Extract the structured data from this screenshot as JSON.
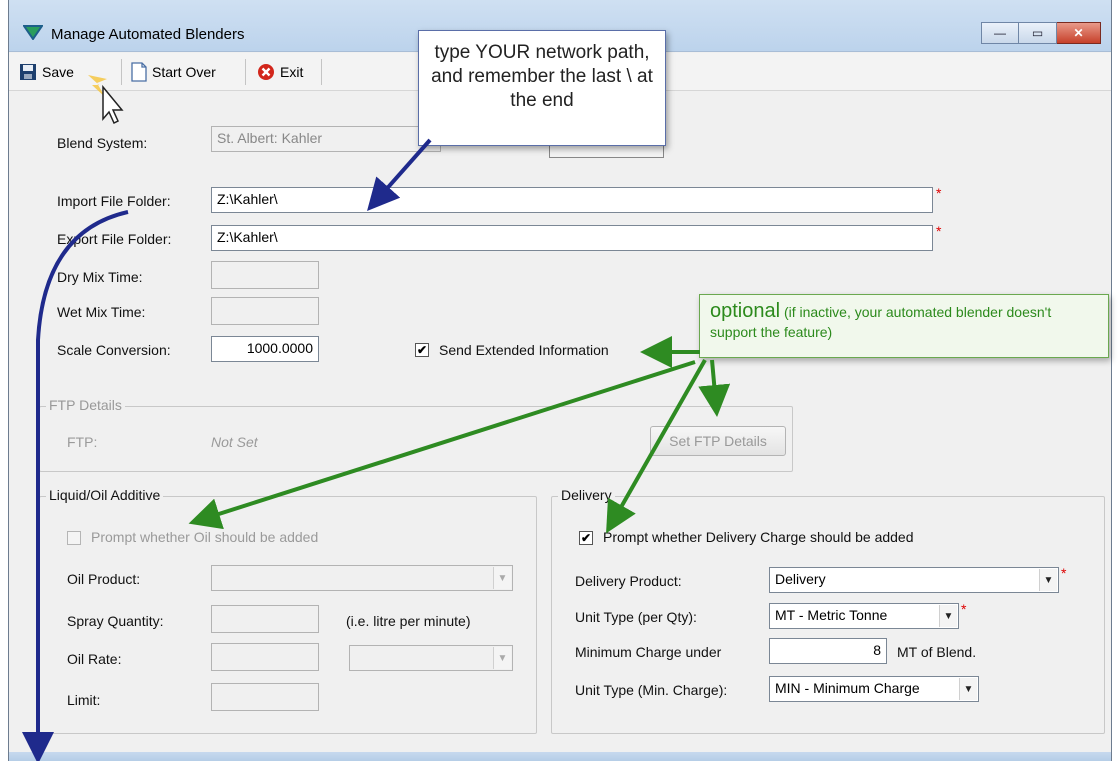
{
  "window": {
    "title": "Manage Automated Blenders",
    "buttons": {
      "minimize": "—",
      "maximize": "▭",
      "close": "✕"
    }
  },
  "toolbar": {
    "save_label": "Save",
    "start_over_label": "Start Over",
    "exit_label": "Exit"
  },
  "form": {
    "blend_system_label": "Blend System:",
    "blend_system_value": "St. Albert: Kahler",
    "import_folder_label": "Import File Folder:",
    "import_folder_value": "Z:\\Kahler\\",
    "export_folder_label": "Export File Folder:",
    "export_folder_value": "Z:\\Kahler\\",
    "dry_mix_label": "Dry Mix Time:",
    "wet_mix_label": "Wet Mix Time:",
    "scale_conversion_label": "Scale Conversion:",
    "scale_conversion_value": "1000.0000",
    "send_extended_label": "Send Extended Information",
    "send_extended_checked": "✔",
    "required_marker": "*"
  },
  "ftp": {
    "group_title": "FTP Details",
    "ftp_label": "FTP:",
    "ftp_value": "Not Set",
    "set_button_label": "Set FTP Details"
  },
  "liquid": {
    "group_title": "Liquid/Oil Additive",
    "prompt_label": "Prompt whether Oil should be added",
    "oil_product_label": "Oil Product:",
    "spray_quantity_label": "Spray Quantity:",
    "spray_hint": "(i.e. litre per minute)",
    "oil_rate_label": "Oil Rate:",
    "limit_label": "Limit:"
  },
  "delivery": {
    "group_title": "Delivery",
    "prompt_label": "Prompt whether Delivery Charge should be added",
    "prompt_checked": "✔",
    "product_label": "Delivery Product:",
    "product_value": "Delivery",
    "unit_type_label": "Unit Type (per Qty):",
    "unit_type_value": "MT - Metric Tonne",
    "min_charge_label": "Minimum Charge under",
    "min_charge_value": "8",
    "min_charge_unit": "MT of Blend.",
    "unit_type_min_label": "Unit Type (Min. Charge):",
    "unit_type_min_value": "MIN - Minimum Charge"
  },
  "callouts": {
    "network_path": "type YOUR network path, and remember the last \\ at the end",
    "optional_big": "optional",
    "optional_rest": " (if inactive, your automated blender doesn't support the feature)"
  },
  "colors": {
    "arrow_blue": "#1f2a8c",
    "arrow_green": "#2e8b22",
    "required_red": "#dd0000"
  }
}
